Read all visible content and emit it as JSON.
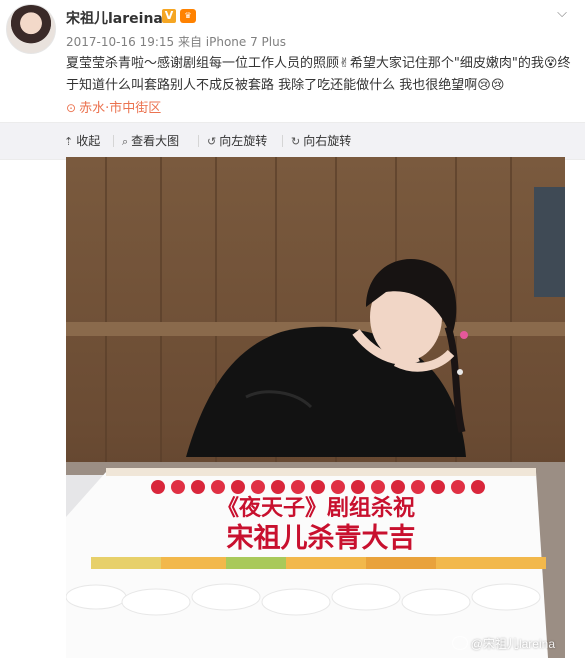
{
  "post": {
    "username": "宋祖儿lareina",
    "vip_badge": "V",
    "level_badge": "♛",
    "more_icon": "chevron-down-icon",
    "meta": "2017-10-16 19:15 来自 iPhone 7 Plus",
    "text_1": "夏莹莹杀青啦～感谢剧组每一位工作人员的照顾",
    "text_2": "希望大家记住那个\"细皮嫩肉\"的我",
    "text_3": "终于知道什么叫套路别人不成反被套路 我除了吃还能做什么 我也很绝望啊",
    "location": "赤水·市中街区"
  },
  "toolbar": {
    "collapse": "收起",
    "view_large": "查看大图",
    "rotate_left": "向左旋转",
    "rotate_right": "向右旋转"
  },
  "photo": {
    "cake_line_1": "《夜天子》剧组杀祝",
    "cake_line_2": "宋祖儿杀青大吉",
    "watermark": "@宋祖儿lareina"
  },
  "colors": {
    "accent": "#eb7350",
    "toolbar_bg": "#f2f2f5",
    "cake_text": "#c8102e"
  }
}
